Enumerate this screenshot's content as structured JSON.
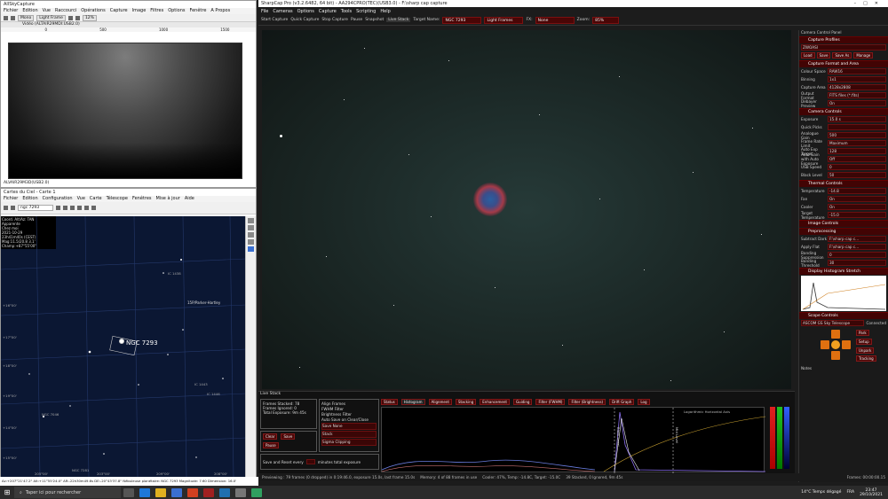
{
  "win1": {
    "title": "AllSkyCapture",
    "menu": [
      "Fichier",
      "Edition",
      "Vue",
      "Raccourci",
      "Opérations",
      "Capture",
      "Image",
      "Filtres",
      "Options",
      "Fenêtre",
      "A Propos"
    ],
    "tool": {
      "mode": "Mono",
      "frames": "Light Frame",
      "zoom": "12%"
    },
    "subtitle": "Vidéo (ALTAIR29MDI:USB2.0)",
    "ruler": [
      "0",
      "500",
      "1000",
      "1500"
    ],
    "status": "ALVAIR29M3D(USB2.0)"
  },
  "win2": {
    "title": "Cartes du Ciel - Carte 1",
    "menu": [
      "Fichier",
      "Edition",
      "Configuration",
      "Vue",
      "Carte",
      "Télescope",
      "Fenêtres",
      "Mise à jour",
      "Aide"
    ],
    "search": "ngc 7293",
    "info": [
      "Coord. Alt/Az: TAN",
      "Apparente",
      "Chez moi",
      "2021-10-29",
      "23h41m40s (CEST)",
      "Mag:11.5/20.8 3.1'",
      "Champ:+87°55'00\""
    ],
    "target": "NGC 7293",
    "labels": [
      "NGC 7046",
      "NGC 7293",
      "IC 1438",
      "IC 1443",
      "NGC 7281",
      "15P/Parker-Hartley",
      "IC 1446",
      "IC 5148"
    ],
    "dec_labels": [
      "+16°00'",
      "+17°00'",
      "+18°00'",
      "+19°00'",
      "+14°00'",
      "+15°00'",
      "+13°00'",
      "+12°00'"
    ],
    "ra_labels": [
      "205°00'",
      "204°00'",
      "203°00'",
      "202°00'",
      "201°00'",
      "200°00'",
      "209°00'",
      "208°00'"
    ],
    "status": "Az:+207°21'47.2\" Alt:+11°55'24.0\"  AR:-22h30m49.6s DE:-20°43'37.8\"  Nébuleuse planétaire: NGC 7293  Magnitude: 7.60  Dimension: 16.0'"
  },
  "sc": {
    "title": "SharpCap Pro (v3.2.6482, 64 bit) - AA294CPRO(TEC)(USB3.0) - F:\\sharp cap capture",
    "menu": [
      "File",
      "Cameras",
      "Options",
      "Capture",
      "Tools",
      "Scripting",
      "Help"
    ],
    "toolbar": {
      "start": "Start Capture",
      "quick": "Quick Capture",
      "stop": "Stop Capture",
      "pause": "Pause",
      "snapshot": "Snapshot",
      "live": "Live Stack",
      "target_label": "Target Name:",
      "target": "NGC 7293",
      "frames": "Light Frames",
      "fx_label": "FX:",
      "fx": "None",
      "zoom_label": "Zoom:",
      "zoom": "85%"
    },
    "panel": {
      "title": "Camera Control Panel",
      "profiles": {
        "header": "Capture Profiles",
        "profile": "ZWOASI",
        "buttons": [
          "Load",
          "Save",
          "Save As",
          "Manage"
        ]
      },
      "format": {
        "header": "Capture Format and Area",
        "rows": [
          [
            "Colour Space",
            "RAW16"
          ],
          [
            "Binning",
            "1x1"
          ],
          [
            "Capture Area",
            "4128x2808"
          ],
          [
            "Output Format",
            "FITS files (*.fits)"
          ],
          [
            "Debayer Preview",
            "On"
          ]
        ]
      },
      "camera": {
        "header": "Camera Controls",
        "rows": [
          [
            "Exposure",
            "15.0 s"
          ],
          [
            "Quick Picks",
            ""
          ],
          [
            "Analogue Gain",
            "500"
          ],
          [
            "Frame Rate Limit",
            "Maximum"
          ],
          [
            "Auto Exp Target",
            "128"
          ],
          [
            "Auto Gain with Auto Exposure",
            "Off"
          ],
          [
            "USB Speed",
            "0"
          ],
          [
            "Black Level",
            "50"
          ]
        ]
      },
      "thermal": {
        "header": "Thermal Controls",
        "rows": [
          [
            "Temperature",
            "-14.8"
          ],
          [
            "Fan",
            "On"
          ],
          [
            "Cooler",
            "On"
          ],
          [
            "Target Temperature",
            "-15.0"
          ]
        ]
      },
      "image": {
        "header": "Image Controls"
      },
      "pre": {
        "header": "Preprocessing",
        "rows": [
          [
            "Subtract Dark",
            "F:\\sharp cap c..."
          ],
          [
            "Apply Flat",
            "F:\\sharp cap c..."
          ],
          [
            "Banding Suppression",
            "0"
          ],
          [
            "Banding Threshold",
            "30"
          ]
        ]
      },
      "histo": {
        "header": "Display Histogram Stretch"
      },
      "scope": {
        "header": "Scope Controls",
        "name": "ASCOM GS Sky Telescope",
        "connected": "Connected",
        "btns": [
          "Park",
          "Setup",
          "Unpark",
          "Tracking"
        ]
      },
      "notes": "Notes"
    },
    "live": {
      "title": "Live Stack",
      "overview": [
        "Frames Stacked: 78",
        "Frames Ignored: 0",
        "Total Exposure: 9m 45s"
      ],
      "controls": [
        "Align Frames",
        "FWHM Filter",
        "Brightness Filter",
        "Auto Save on Clear/Close"
      ],
      "raw": "Save None",
      "view": "Stack",
      "stacking": "Sigma Clipping",
      "actions": [
        "Clear",
        "Save",
        "Pause"
      ],
      "advanced": "Save and Reset every",
      "minutes": "minutes total exposure",
      "tabs": [
        "Status",
        "Histogram",
        "Alignment",
        "Stacking",
        "Enhancement",
        "Guiding",
        "Filter (FWHM)",
        "Filter (Brightness)",
        "Drift Graph",
        "Log"
      ],
      "graph_checkbox": "Logarithmic Horizontal Axis",
      "mid_label": "Mid Level",
      "black_label": "Black Level"
    },
    "status": [
      "Previewing : 79 frames (0 dropped) in 0:19:46.0, exposure 15.0s, last frame 15.0s",
      "Memory: 4 of 88 frames in use",
      "Cooler: 47%, Temp: -14.8C, Target: -15.0C",
      "39 Stacked, 0 Ignored, 9m 45s"
    ],
    "frames_info": "Frames: 00:00:00.15"
  },
  "taskbar": {
    "search": "Taper ici pour rechercher",
    "weather": "14°C Temps dégagé",
    "lang": "FRA",
    "time": "23:47",
    "date": "29/10/2021"
  }
}
